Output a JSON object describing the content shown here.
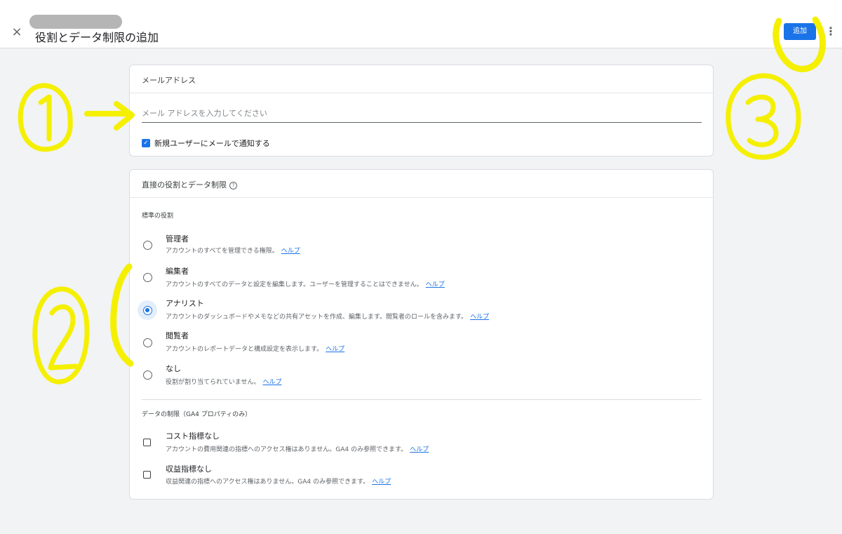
{
  "header": {
    "title": "役割とデータ制限の追加",
    "add_label": "追加",
    "close_glyph": "×",
    "more_glyph": "⋮"
  },
  "email_card": {
    "header": "メールアドレス",
    "input_value": "",
    "input_placeholder": "メール アドレスを入力してください",
    "notify_label": "新規ユーザーにメールで通知する",
    "notify_checked": true
  },
  "roles_card": {
    "header": "直接の役割とデータ制限",
    "help_glyph": "?",
    "standard_roles_label": "標準の役割",
    "help_link": "ヘルプ",
    "roles": [
      {
        "title": "管理者",
        "desc": "アカウントのすべてを管理できる権限。",
        "selected": false
      },
      {
        "title": "編集者",
        "desc": "アカウントのすべてのデータと設定を編集します。ユーザーを管理することはできません。",
        "selected": false
      },
      {
        "title": "アナリスト",
        "desc": "アカウントのダッシュボードやメモなどの共有アセットを作成、編集します。閲覧者のロールを含みます。",
        "selected": true
      },
      {
        "title": "閲覧者",
        "desc": "アカウントのレポートデータと構成設定を表示します。",
        "selected": false
      },
      {
        "title": "なし",
        "desc": "役割が割り当てられていません。",
        "selected": false
      }
    ],
    "data_restrictions_label": "データの制限（GA4 プロパティのみ）",
    "restrictions": [
      {
        "title": "コスト指標なし",
        "desc": "アカウントの費用関連の指標へのアクセス権はありません。GA4 のみ参照できます。",
        "checked": false
      },
      {
        "title": "収益指標なし",
        "desc": "収益関連の指標へのアクセス権はありません。GA4 のみ参照できます。",
        "checked": false
      }
    ]
  },
  "colors": {
    "accent": "#1a73e8",
    "annotation": "#f5ef00"
  }
}
